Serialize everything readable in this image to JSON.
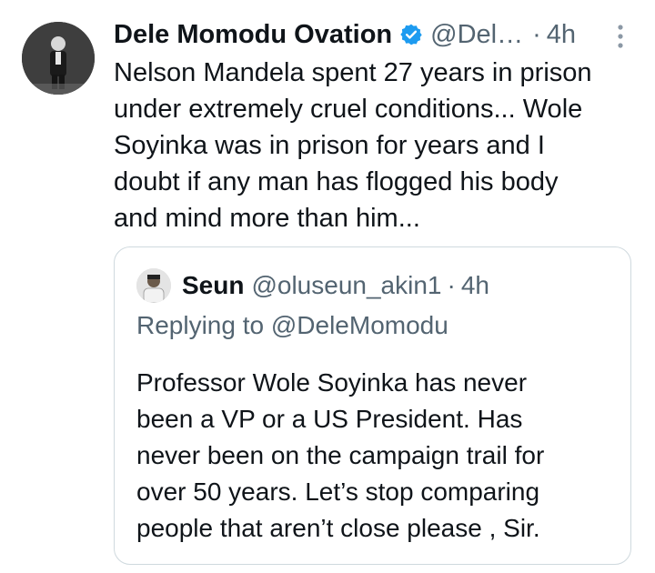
{
  "tweet": {
    "display_name": "Dele Momodu Ovation",
    "handle": "@Del…",
    "separator": "·",
    "time": "4h",
    "verified_icon": "verified-badge-icon",
    "more_icon": "more-vertical-icon",
    "text": "Nelson Mandela spent 27 years in prison\nunder extremely cruel conditions... Wole\nSoyinka was in prison for years and I\ndoubt if any man has flogged his body\nand mind more than him..."
  },
  "quoted": {
    "display_name": "Seun",
    "handle": "@oluseun_akin1",
    "separator": "·",
    "time": "4h",
    "replying_to": "Replying to @DeleMomodu",
    "text": "Professor Wole Soyinka has never\nbeen a VP or a US President. Has\nnever been on the campaign trail for\nover 50 years. Let’s stop comparing\npeople that aren’t close please , Sir."
  },
  "colors": {
    "text_primary": "#0f1419",
    "text_secondary": "#536471",
    "verified_blue": "#1d9bf0",
    "border": "#cfd9de"
  }
}
